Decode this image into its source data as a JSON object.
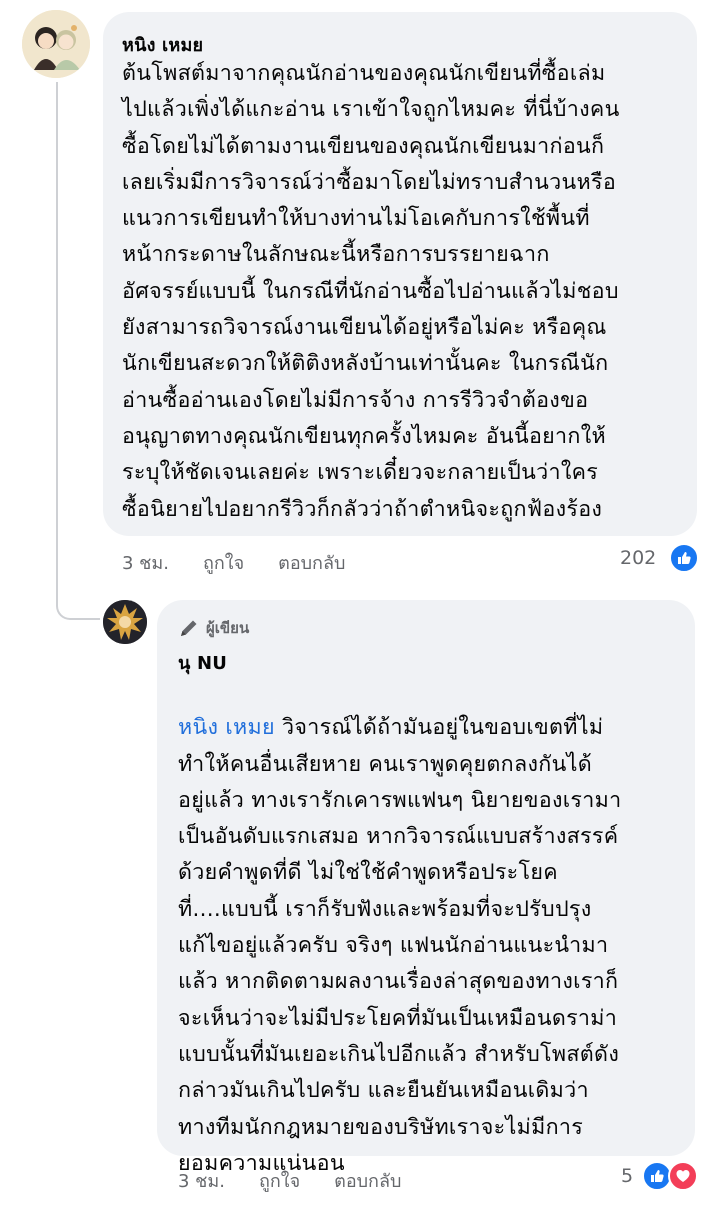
{
  "comment1": {
    "author": "หนิง เหมย",
    "text": "ต้นโพสต์มาจากคุณนักอ่านของคุณนักเขียนที่ซื้อเล่ม\nไปแล้วเพิ่งได้แกะอ่าน เราเข้าใจถูกไหมคะ ที่นี่บ้างคน\nซื้อโดยไม่ได้ตามงานเขียนของคุณนักเขียนมาก่อนก็\nเลยเริ่มมีการวิจารณ์ว่าซื้อมาโดยไม่ทราบสำนวนหรือ\nแนวการเขียนทำให้บางท่านไม่โอเคกับการใช้พื้นที่\nหน้ากระดาษในลักษณะนี้หรือการบรรยายฉาก\nอัศจรรย์แบบนี้ ในกรณีที่นักอ่านซื้อไปอ่านแล้วไม่ชอบ\nยังสามารถวิจารณ์งานเขียนได้อยู่หรือไม่คะ หรือคุณ\nนักเขียนสะดวกให้ติติงหลังบ้านเท่านั้นคะ ในกรณีนัก\nอ่านซื้ออ่านเองโดยไม่มีการจ้าง การรีวิวจำต้องขอ\nอนุญาตทางคุณนักเขียนทุกครั้งไหมคะ อันนี้อยากให้\nระบุให้ชัดเจนเลยค่ะ เพราะเดี๋ยวจะกลายเป็นว่าใคร\nซื้อนิยายไปอยากรีวิวก็กลัวว่าถ้าตำหนิจะถูกฟ้องร้อง",
    "time": "3 ชม.",
    "like": "ถูกใจ",
    "reply": "ตอบกลับ",
    "reaction_count": "202",
    "reaction_icons": [
      "like-icon"
    ]
  },
  "comment2": {
    "badge": "ผู้เขียน",
    "badge_icon": "pen-icon",
    "author": "นุ NU",
    "mention": "หนิง เหมย",
    "text_first": " วิจารณ์ได้ถ้ามันอยู่ในขอบเขตที่ไม่",
    "text": "ทำให้คนอื่นเสียหาย คนเราพูดคุยตกลงกันได้\nอยู่แล้ว ทางเรารักเคารพแฟนๆ นิยายของเรามา\nเป็นอันดับแรกเสมอ หากวิจารณ์แบบสร้างสรรค์\nด้วยคำพูดที่ดี ไม่ใช่ใช้คำพูดหรือประโยค\nที่....แบบนี้ เราก็รับฟังและพร้อมที่จะปรับปรุง\nแก้ไขอยู่แล้วครับ จริงๆ แฟนนักอ่านแนะนำมา\nแล้ว หากติดตามผลงานเรื่องล่าสุดของทางเราก็\nจะเห็นว่าจะไม่มีประโยคที่มันเป็นเหมือนดราม่า\nแบบนั้นที่มันเยอะเกินไปอีกแล้ว สำหรับโพสต์ดัง\nกล่าวมันเกินไปครับ และยืนยันเหมือนเดิมว่า\nทางทีมนักกฎหมายของบริษัทเราจะไม่มีการ\nยอมความแน่นอน",
    "time": "3 ชม.",
    "like": "ถูกใจ",
    "reply": "ตอบกลับ",
    "reaction_count": "5",
    "reaction_icons": [
      "like-icon",
      "love-icon"
    ]
  }
}
